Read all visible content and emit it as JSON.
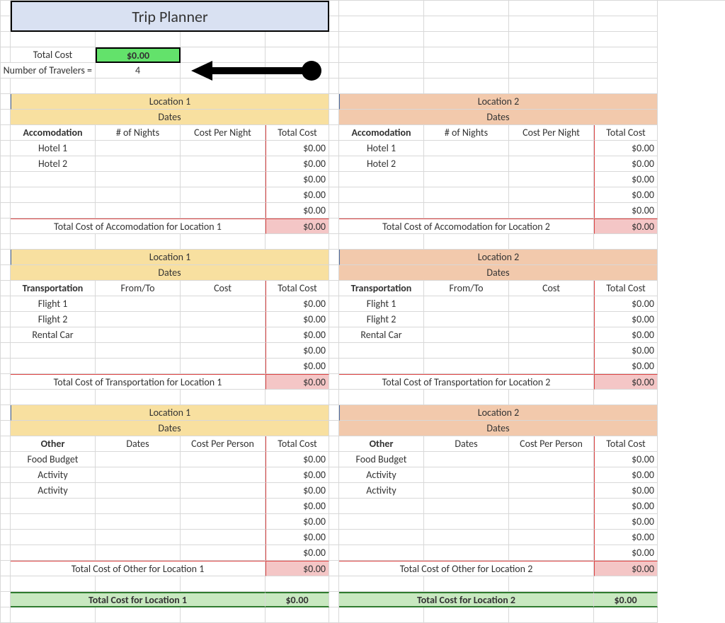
{
  "title": "Trip Planner",
  "summary": {
    "total_cost_label": "Total Cost",
    "total_cost_value": "$0.00",
    "num_travelers_label": "Number of Travelers  =",
    "num_travelers_value": "4"
  },
  "sections": {
    "accommodation": {
      "col_headers": [
        "Accomodation",
        "# of Nights",
        "Cost Per Night",
        "Total Cost"
      ],
      "rows_loc1": [
        "Hotel 1",
        "Hotel 2",
        "",
        "",
        ""
      ],
      "rows_loc2": [
        "Hotel 1",
        "Hotel 2",
        "",
        "",
        ""
      ],
      "row_totals": [
        "$0.00",
        "$0.00",
        "$0.00",
        "$0.00",
        "$0.00"
      ],
      "sub_label_1": "Total Cost of Accomodation for Location 1",
      "sub_label_2": "Total Cost of Accomodation for Location 2",
      "sub_total": "$0.00"
    },
    "transportation": {
      "col_headers": [
        "Transportation",
        "From/To",
        "Cost",
        "Total Cost"
      ],
      "rows_loc1": [
        "Flight 1",
        "Flight 2",
        "Rental Car",
        "",
        ""
      ],
      "rows_loc2": [
        "Flight 1",
        "Flight 2",
        "Rental Car",
        "",
        ""
      ],
      "row_totals": [
        "$0.00",
        "$0.00",
        "$0.00",
        "$0.00",
        "$0.00"
      ],
      "sub_label_1": "Total Cost of Transportation for Location 1",
      "sub_label_2": "Total Cost of Transportation for Location 2",
      "sub_total": "$0.00"
    },
    "other": {
      "col_headers": [
        "Other",
        "Dates",
        "Cost Per Person",
        "Total Cost"
      ],
      "rows_loc1": [
        "Food Budget",
        "Activity",
        "Activity",
        "",
        "",
        "",
        ""
      ],
      "rows_loc2": [
        "Food Budget",
        "Activity",
        "Activity",
        "",
        "",
        "",
        ""
      ],
      "row_totals": [
        "$0.00",
        "$0.00",
        "$0.00",
        "$0.00",
        "$0.00",
        "$0.00",
        "$0.00"
      ],
      "sub_label_1": "Total Cost of Other for Location 1",
      "sub_label_2": "Total Cost of Other for Location 2",
      "sub_total": "$0.00"
    }
  },
  "loc1": {
    "header": "Location 1",
    "dates": "Dates"
  },
  "loc2": {
    "header": "Location 2",
    "dates": "Dates"
  },
  "grand": {
    "label_1": "Total Cost for Location 1",
    "label_2": "Total Cost for Location 2",
    "value": "$0.00"
  },
  "chart_data": {
    "type": "table",
    "title": "Trip Planner",
    "totals": {
      "grand_total": 0.0,
      "travelers": 4
    },
    "locations": [
      {
        "name": "Location 1",
        "accommodation": {
          "items": [
            "Hotel 1",
            "Hotel 2"
          ],
          "subtotal": 0.0
        },
        "transportation": {
          "items": [
            "Flight 1",
            "Flight 2",
            "Rental Car"
          ],
          "subtotal": 0.0
        },
        "other": {
          "items": [
            "Food Budget",
            "Activity",
            "Activity"
          ],
          "subtotal": 0.0
        },
        "total": 0.0
      },
      {
        "name": "Location 2",
        "accommodation": {
          "items": [
            "Hotel 1",
            "Hotel 2"
          ],
          "subtotal": 0.0
        },
        "transportation": {
          "items": [
            "Flight 1",
            "Flight 2",
            "Rental Car"
          ],
          "subtotal": 0.0
        },
        "other": {
          "items": [
            "Food Budget",
            "Activity",
            "Activity"
          ],
          "subtotal": 0.0
        },
        "total": 0.0
      }
    ]
  }
}
